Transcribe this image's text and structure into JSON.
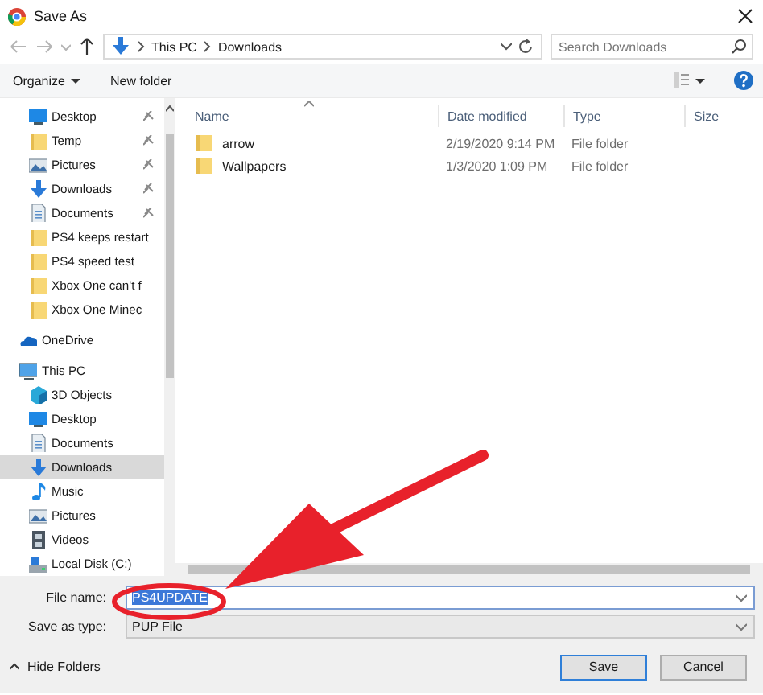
{
  "window": {
    "title": "Save As"
  },
  "address_bar": {
    "path": [
      "This PC",
      "Downloads"
    ],
    "search": {
      "placeholder": "Search Downloads"
    }
  },
  "toolbar": {
    "organize": "Organize",
    "new_folder": "New folder"
  },
  "sidebar": {
    "items": [
      {
        "label": "Desktop",
        "kind": "desktop",
        "pinned": true,
        "selected": false
      },
      {
        "label": "Temp",
        "kind": "folder",
        "pinned": true,
        "selected": false
      },
      {
        "label": "Pictures",
        "kind": "pictures",
        "pinned": true,
        "selected": false
      },
      {
        "label": "Downloads",
        "kind": "downloads",
        "pinned": true,
        "selected": false
      },
      {
        "label": "Documents",
        "kind": "documents",
        "pinned": true,
        "selected": false
      },
      {
        "label": "PS4 keeps restart",
        "kind": "folder",
        "pinned": false,
        "selected": false
      },
      {
        "label": "PS4 speed test",
        "kind": "folder",
        "pinned": false,
        "selected": false
      },
      {
        "label": "Xbox One can't f",
        "kind": "folder",
        "pinned": false,
        "selected": false
      },
      {
        "label": "Xbox One Minec",
        "kind": "folder",
        "pinned": false,
        "selected": false
      },
      {
        "label": "OneDrive",
        "kind": "cloud",
        "pinned": false,
        "selected": false
      },
      {
        "label": "This PC",
        "kind": "pc",
        "pinned": false,
        "selected": false,
        "children": [
          {
            "label": "3D Objects",
            "kind": "cube",
            "pinned": false,
            "selected": false
          },
          {
            "label": "Desktop",
            "kind": "desktop",
            "pinned": false,
            "selected": false
          },
          {
            "label": "Documents",
            "kind": "documents",
            "pinned": false,
            "selected": false
          },
          {
            "label": "Downloads",
            "kind": "downloads",
            "pinned": false,
            "selected": true
          },
          {
            "label": "Music",
            "kind": "music",
            "pinned": false,
            "selected": false
          },
          {
            "label": "Pictures",
            "kind": "pictures",
            "pinned": false,
            "selected": false
          },
          {
            "label": "Videos",
            "kind": "videos",
            "pinned": false,
            "selected": false
          },
          {
            "label": "Local Disk (C:)",
            "kind": "disk",
            "pinned": false,
            "selected": false
          }
        ]
      }
    ]
  },
  "file_list": {
    "columns": [
      "Name",
      "Date modified",
      "Type",
      "Size"
    ],
    "rows": [
      {
        "name": "arrow",
        "date_modified": "2/19/2020 9:14 PM",
        "type": "File folder"
      },
      {
        "name": "Wallpapers",
        "date_modified": "1/3/2020 1:09 PM",
        "type": "File folder"
      }
    ]
  },
  "form": {
    "file_name": {
      "label": "File name:",
      "value": "PS4UPDATE",
      "selected": true
    },
    "save_as_type": {
      "label": "Save as type:",
      "value": "PUP File"
    }
  },
  "footer": {
    "hide_folders": "Hide Folders",
    "buttons": [
      {
        "label": "Save",
        "default": true
      },
      {
        "label": "Cancel",
        "default": false
      }
    ]
  }
}
